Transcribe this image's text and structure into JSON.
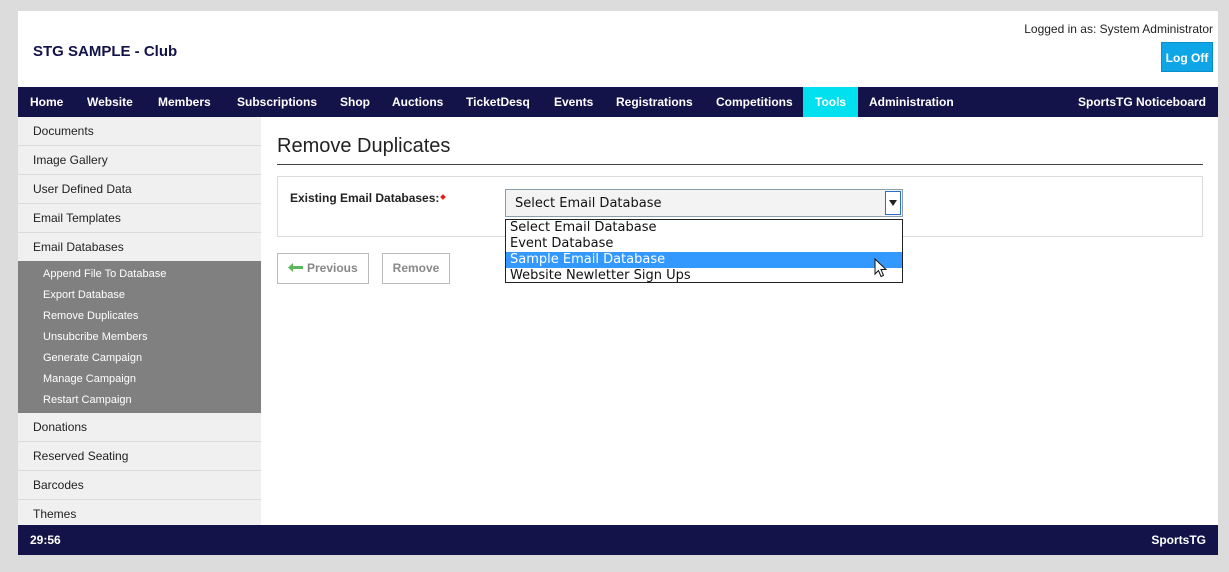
{
  "header": {
    "site_title": "STG SAMPLE - Club",
    "login_text": "Logged in as: System Administrator",
    "logoff_label": "Log Off"
  },
  "nav": {
    "items": [
      {
        "label": "Home"
      },
      {
        "label": "Website"
      },
      {
        "label": "Members"
      },
      {
        "label": "Subscriptions"
      },
      {
        "label": "Shop"
      },
      {
        "label": "Auctions"
      },
      {
        "label": "TicketDesq"
      },
      {
        "label": "Events"
      },
      {
        "label": "Registrations"
      },
      {
        "label": "Competitions"
      },
      {
        "label": "Tools"
      },
      {
        "label": "Administration"
      }
    ],
    "active": "Tools",
    "right_label": "SportsTG Noticeboard"
  },
  "sidebar": {
    "items_top": [
      {
        "label": "Documents"
      },
      {
        "label": "Image Gallery"
      },
      {
        "label": "User Defined Data"
      },
      {
        "label": "Email Templates"
      },
      {
        "label": "Email Databases"
      }
    ],
    "subitems": [
      {
        "label": "Append File To Database"
      },
      {
        "label": "Export Database"
      },
      {
        "label": "Remove Duplicates"
      },
      {
        "label": "Unsubcribe Members"
      },
      {
        "label": "Generate Campaign"
      },
      {
        "label": "Manage Campaign"
      },
      {
        "label": "Restart Campaign"
      }
    ],
    "items_bottom": [
      {
        "label": "Donations"
      },
      {
        "label": "Reserved Seating"
      },
      {
        "label": "Barcodes"
      },
      {
        "label": "Themes"
      }
    ]
  },
  "main": {
    "page_title": "Remove Duplicates",
    "field_label": "Existing Email Databases:",
    "select_value": "Select Email Database",
    "options": [
      {
        "label": "Select Email Database"
      },
      {
        "label": "Event Database"
      },
      {
        "label": "Sample Email Database"
      },
      {
        "label": "Website Newletter Sign Ups"
      }
    ],
    "highlighted_option": "Sample Email Database",
    "previous_label": "Previous",
    "remove_label": "Remove"
  },
  "footer": {
    "timer": "29:56",
    "brand": "SportsTG"
  },
  "colors": {
    "nav_bg": "#13134a",
    "active_tab": "#00e0ef",
    "logoff_bg": "#0fa6e8",
    "highlight": "#3399ff",
    "subnav_bg": "#808080"
  }
}
